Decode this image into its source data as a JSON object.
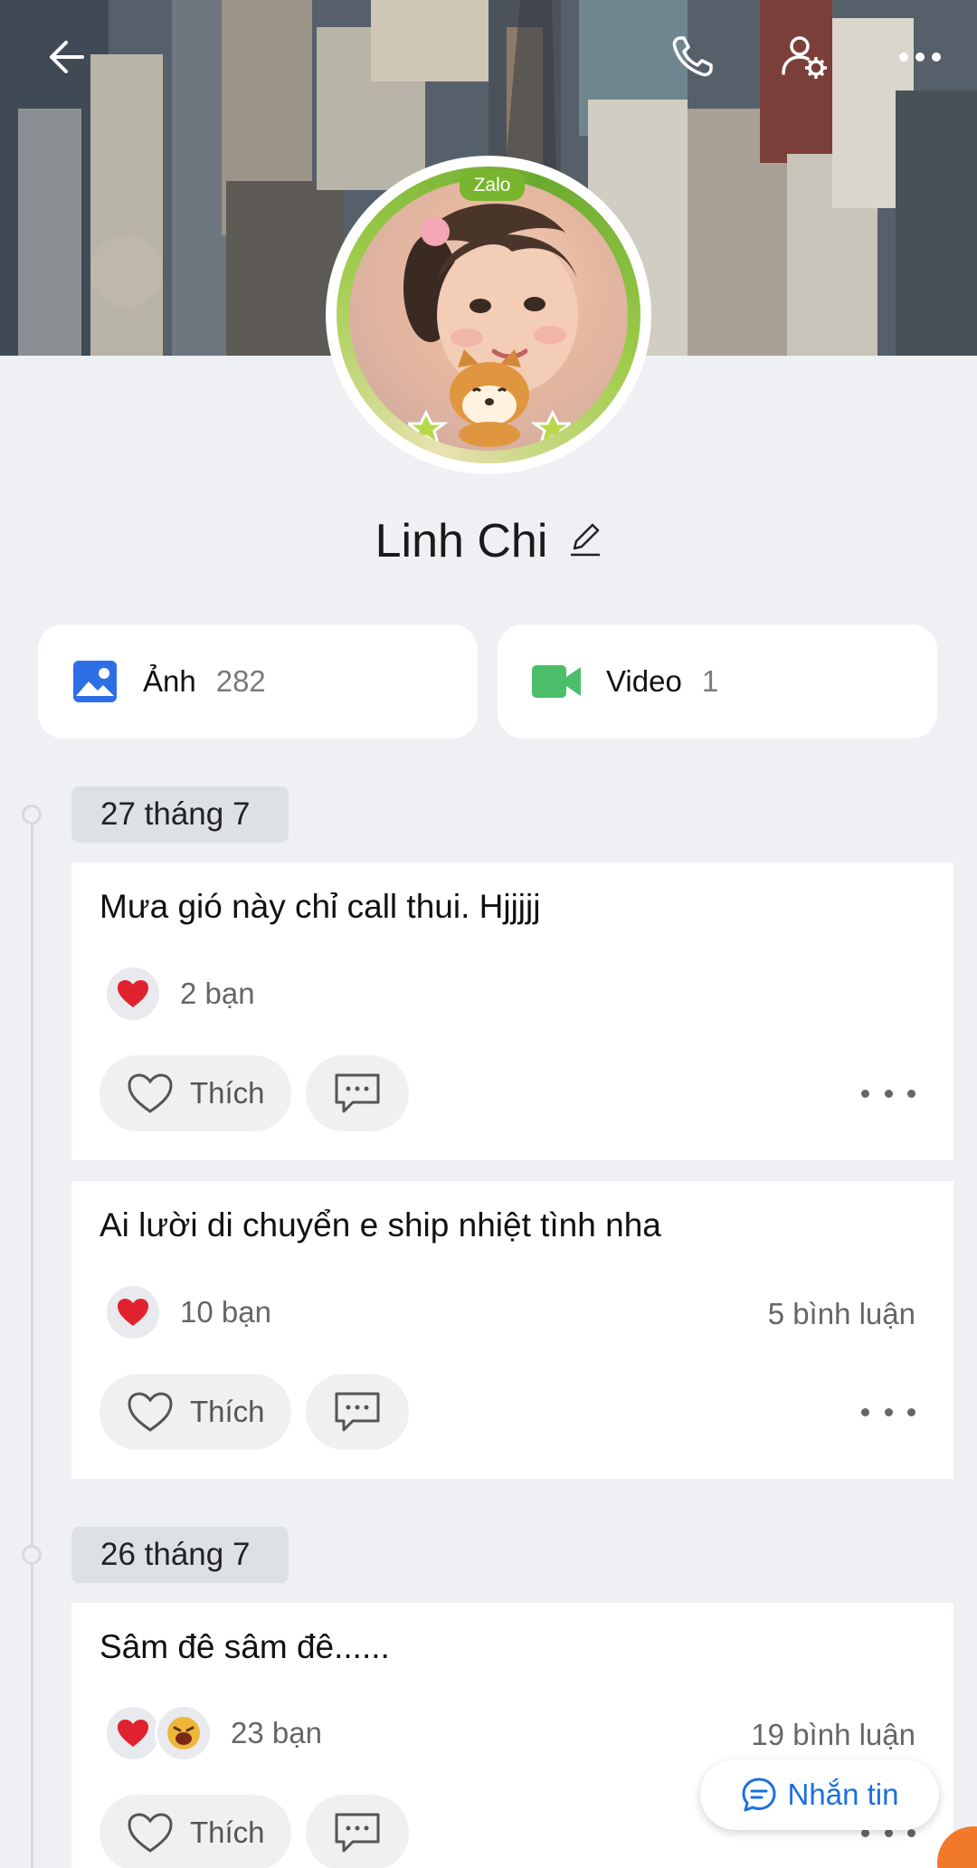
{
  "profile": {
    "name": "Linh Chi",
    "badge": "Zalo"
  },
  "header": {
    "icons": [
      "back-arrow-icon",
      "phone-icon",
      "user-settings-icon",
      "more-icon"
    ]
  },
  "media": [
    {
      "label": "Ảnh",
      "count": "282",
      "icon": "image-icon",
      "color": "#2f6fe6"
    },
    {
      "label": "Video",
      "count": "1",
      "icon": "video-camera-icon",
      "color": "#4cbe6a"
    }
  ],
  "timeline": [
    {
      "date": "27 tháng 7",
      "posts": [
        {
          "text": "Mưa gió này chỉ call thui. Hjjjjj",
          "reactions": "2 bạn",
          "comments": "",
          "like_label": "Thích"
        },
        {
          "text": "Ai lười di chuyển e ship nhiệt tình nha",
          "reactions": "10 bạn",
          "comments": "5 bình luận",
          "like_label": "Thích"
        }
      ]
    },
    {
      "date": "26 tháng 7",
      "posts": [
        {
          "text": "Sâm đê sâm đê......",
          "reactions": "23 bạn",
          "comments": "19 bình luận",
          "like_label": "Thích"
        }
      ]
    }
  ],
  "message_button": {
    "label": "Nhắn tin"
  },
  "colors": {
    "accent": "#1b6fe0",
    "heart": "#e0222f",
    "badge": "#79b52e"
  }
}
